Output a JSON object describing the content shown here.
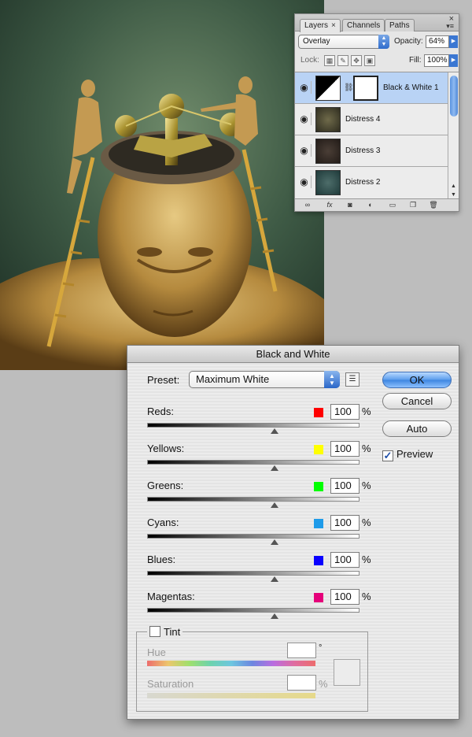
{
  "layers_panel": {
    "tabs": [
      {
        "label": "Layers",
        "close": "×"
      },
      {
        "label": "Channels"
      },
      {
        "label": "Paths"
      }
    ],
    "blend_mode": "Overlay",
    "opacity_label": "Opacity:",
    "opacity_value": "64%",
    "lock_label": "Lock:",
    "fill_label": "Fill:",
    "fill_value": "100%",
    "layers": [
      {
        "name": "Black & White 1",
        "selected": true
      },
      {
        "name": "Distress 4"
      },
      {
        "name": "Distress 3"
      },
      {
        "name": "Distress 2"
      }
    ],
    "bottom_icons": [
      "link-icon",
      "fx-icon",
      "mask-icon",
      "adjustment-icon",
      "folder-icon",
      "new-layer-icon",
      "trash-icon"
    ]
  },
  "bw_dialog": {
    "title": "Black and White",
    "preset_label": "Preset:",
    "preset_value": "Maximum White",
    "buttons": {
      "ok": "OK",
      "cancel": "Cancel",
      "auto": "Auto"
    },
    "preview_label": "Preview",
    "preview_checked": true,
    "percent": "%",
    "sliders": [
      {
        "label": "Reds:",
        "value": "100",
        "color": "#ff0000",
        "position": 0.6
      },
      {
        "label": "Yellows:",
        "value": "100",
        "color": "#ffff00",
        "position": 0.6
      },
      {
        "label": "Greens:",
        "value": "100",
        "color": "#00ff00",
        "position": 0.6
      },
      {
        "label": "Cyans:",
        "value": "100",
        "color": "#1e9be9",
        "position": 0.6
      },
      {
        "label": "Blues:",
        "value": "100",
        "color": "#0a00ff",
        "position": 0.6
      },
      {
        "label": "Magentas:",
        "value": "100",
        "color": "#e5007a",
        "position": 0.6
      }
    ],
    "tint": {
      "label": "Tint",
      "checked": false,
      "hue_label": "Hue",
      "hue_unit": "°",
      "saturation_label": "Saturation",
      "saturation_unit": "%"
    }
  }
}
